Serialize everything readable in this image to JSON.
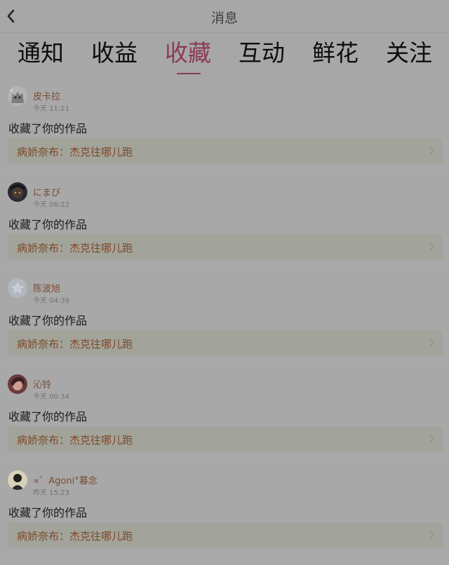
{
  "header": {
    "title": "消息",
    "back_icon": "chevron-left-icon"
  },
  "tabs": [
    {
      "label": "通知",
      "active": false
    },
    {
      "label": "收益",
      "active": false
    },
    {
      "label": "收藏",
      "active": true
    },
    {
      "label": "互动",
      "active": false
    },
    {
      "label": "鲜花",
      "active": false
    },
    {
      "label": "关注",
      "active": false
    }
  ],
  "colors": {
    "active_tab": "#8a3b58",
    "username": "#7a4a32",
    "work_title": "#7f4725",
    "background": "#a9a9a9"
  },
  "notifications": [
    {
      "username": "皮卡拉",
      "time": "今天 11:21",
      "action": "收藏了你的作品",
      "work": "病娇奈布：杰克往哪儿跑",
      "avatar": "avatar-cat"
    },
    {
      "username": "にまび",
      "time": "今天 06:22",
      "action": "收藏了你的作品",
      "work": "病娇奈布：杰克往哪儿跑",
      "avatar": "avatar-dark"
    },
    {
      "username": "陈波旭",
      "time": "今天 04:39",
      "action": "收藏了你的作品",
      "work": "病娇奈布：杰克往哪儿跑",
      "avatar": "avatar-default-star"
    },
    {
      "username": "沁铃",
      "time": "今天 00:34",
      "action": "收藏了你的作品",
      "work": "病娇奈布：杰克往哪儿跑",
      "avatar": "avatar-anime"
    },
    {
      "username": "∝゛Agoni°暮念",
      "time": "昨天 15:23",
      "action": "收藏了你的作品",
      "work": "病娇奈布：杰克往哪儿跑",
      "avatar": "avatar-figure"
    }
  ]
}
